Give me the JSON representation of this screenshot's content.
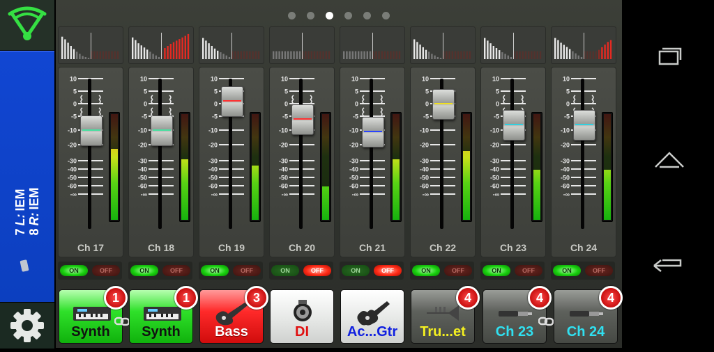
{
  "sidebar": {
    "mix_line1": "7 L: IEM",
    "mix_line2": "8 R: IEM",
    "mix_num1": "7",
    "mix_side1": "L:",
    "mix_dest1": "IEM",
    "mix_num2": "8",
    "mix_side2": "R:",
    "mix_dest2": "IEM"
  },
  "pager": {
    "pages": 6,
    "active_page": 3
  },
  "scale_labels": [
    "10",
    "5",
    "0",
    "-5",
    "-10",
    "-20",
    "-30",
    "-40",
    "-50",
    "-60",
    "-∞"
  ],
  "switch_labels": {
    "on": "ON",
    "off": "OFF"
  },
  "channels": [
    {
      "label": "Ch 17",
      "fader_db": -10,
      "fader_line_color": "#46e0a0",
      "meter_level": 0.68,
      "on": true,
      "name": "Synth",
      "tile_color": "green",
      "name_color": "#111",
      "badge": "1",
      "icon": "keyboard-icon",
      "linked": true
    },
    {
      "label": "Ch 18",
      "fader_db": -10,
      "fader_line_color": "#46e0a0",
      "meter_level": 0.58,
      "on": true,
      "name": "Synth",
      "tile_color": "green",
      "name_color": "#111",
      "badge": "1",
      "icon": "keyboard-icon",
      "linked": false
    },
    {
      "label": "Ch 19",
      "fader_db": 1,
      "fader_line_color": "#ff3030",
      "meter_level": 0.52,
      "on": true,
      "name": "Bass",
      "tile_color": "red",
      "name_color": "#fff",
      "badge": "3",
      "icon": "electric-guitar-icon",
      "linked": false
    },
    {
      "label": "Ch 20",
      "fader_db": -6,
      "fader_line_color": "#ff3030",
      "meter_level": 0.32,
      "on": false,
      "name": "DI",
      "tile_color": "white",
      "name_color": "#e01010",
      "badge": "",
      "icon": "di-box-icon",
      "linked": false
    },
    {
      "label": "Ch 21",
      "fader_db": -11,
      "fader_line_color": "#2a44ff",
      "meter_level": 0.58,
      "on": false,
      "name": "Ac...Gtr",
      "tile_color": "white",
      "name_color": "#1020e0",
      "badge": "",
      "icon": "acoustic-guitar-icon",
      "linked": false
    },
    {
      "label": "Ch 22",
      "fader_db": 0,
      "fader_line_color": "#f0e020",
      "meter_level": 0.66,
      "on": true,
      "name": "Tru...et",
      "tile_color": "gray",
      "name_color": "#f4f020",
      "badge": "4",
      "icon": "trumpet-icon",
      "linked": false
    },
    {
      "label": "Ch 23",
      "fader_db": -8,
      "fader_line_color": "#30d0e0",
      "meter_level": 0.48,
      "on": true,
      "name": "Ch 23",
      "tile_color": "gray",
      "name_color": "#30e0f0",
      "badge": "4",
      "icon": "cable-icon",
      "linked": true
    },
    {
      "label": "Ch 24",
      "fader_db": -8,
      "fader_line_color": "#30d0e0",
      "meter_level": 0.48,
      "on": true,
      "name": "Ch 24",
      "tile_color": "gray",
      "name_color": "#30e0f0",
      "badge": "4",
      "icon": "cable-icon",
      "linked": false
    }
  ],
  "meter_history": [
    [
      0.85,
      0.75,
      0.62,
      0.5,
      0.38,
      0.28,
      0.2,
      0.12,
      0.08,
      0.05,
      0.3,
      0.3,
      0.3,
      0.3,
      0.3,
      0.3,
      0.3,
      0.3,
      0.3,
      0.3
    ],
    [
      0.82,
      0.72,
      0.6,
      0.52,
      0.44,
      0.36,
      0.28,
      0.2,
      0.14,
      0.08,
      0.3,
      0.42,
      0.5,
      0.58,
      0.64,
      0.7,
      0.76,
      0.82,
      0.88,
      0.95
    ],
    [
      0.8,
      0.7,
      0.6,
      0.5,
      0.4,
      0.32,
      0.26,
      0.2,
      0.14,
      0.08,
      0.3,
      0.3,
      0.3,
      0.3,
      0.3,
      0.3,
      0.3,
      0.3,
      0.3,
      0.3
    ],
    [
      0.3,
      0.3,
      0.3,
      0.3,
      0.3,
      0.3,
      0.3,
      0.3,
      0.3,
      0.3,
      0.3,
      0.3,
      0.3,
      0.3,
      0.3,
      0.3,
      0.3,
      0.3,
      0.3,
      0.3
    ],
    [
      0.3,
      0.3,
      0.3,
      0.3,
      0.3,
      0.3,
      0.3,
      0.3,
      0.3,
      0.3,
      0.3,
      0.3,
      0.3,
      0.3,
      0.3,
      0.3,
      0.3,
      0.3,
      0.3,
      0.3
    ],
    [
      0.75,
      0.65,
      0.55,
      0.45,
      0.35,
      0.28,
      0.2,
      0.14,
      0.08,
      0.05,
      0.3,
      0.3,
      0.3,
      0.3,
      0.3,
      0.3,
      0.3,
      0.3,
      0.3,
      0.3
    ],
    [
      0.8,
      0.7,
      0.6,
      0.5,
      0.42,
      0.34,
      0.26,
      0.2,
      0.14,
      0.08,
      0.3,
      0.3,
      0.3,
      0.3,
      0.3,
      0.3,
      0.3,
      0.3,
      0.3,
      0.3
    ],
    [
      0.8,
      0.72,
      0.62,
      0.54,
      0.46,
      0.38,
      0.3,
      0.22,
      0.14,
      0.08,
      0.3,
      0.3,
      0.3,
      0.3,
      0.3,
      0.35,
      0.45,
      0.55,
      0.65,
      0.72
    ]
  ],
  "nav": {
    "recents": "recents-icon",
    "home": "home-icon",
    "back": "back-icon"
  }
}
